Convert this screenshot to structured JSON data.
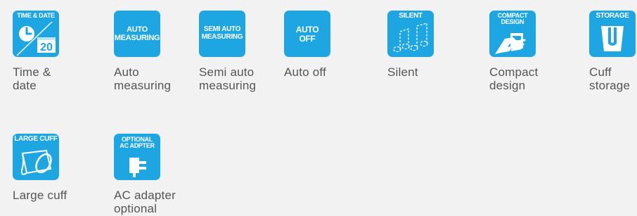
{
  "features": [
    {
      "id": "time-date",
      "badge": "TIME & DATE",
      "badge_number": "20",
      "label": "Time &\ndate",
      "icon": "clock-calendar-icon"
    },
    {
      "id": "auto-measuring",
      "badge": "AUTO\nMEASURING",
      "label": "Auto\nmeasuring",
      "icon": "text-badge"
    },
    {
      "id": "semi-auto",
      "badge": "SEMI AUTO\nMEASURING",
      "label": "Semi auto\nmeasuring",
      "icon": "text-badge"
    },
    {
      "id": "auto-off",
      "badge": "AUTO\nOFF",
      "label": "Auto off",
      "icon": "text-badge"
    },
    {
      "id": "silent",
      "badge": "SILENT",
      "label": "Silent",
      "icon": "music-notes-icon"
    },
    {
      "id": "compact",
      "badge": "COMPACT\nDESIGN",
      "label": "Compact\ndesign",
      "icon": "hand-holding-icon"
    },
    {
      "id": "storage",
      "badge": "STORAGE",
      "label": "Cuff\nstorage",
      "icon": "storage-box-icon"
    },
    {
      "id": "large-cuff",
      "badge": "LARGE CUFF",
      "label": "Large cuff",
      "icon": "cuff-icon"
    },
    {
      "id": "ac-adapter",
      "badge": "OPTIONAL\nAC ADPTER",
      "label": "AC adapter\noptional",
      "icon": "plug-icon"
    }
  ],
  "colors": {
    "badge": "#1ea6e3",
    "text": "#555555",
    "background": "#f2f2f2"
  }
}
